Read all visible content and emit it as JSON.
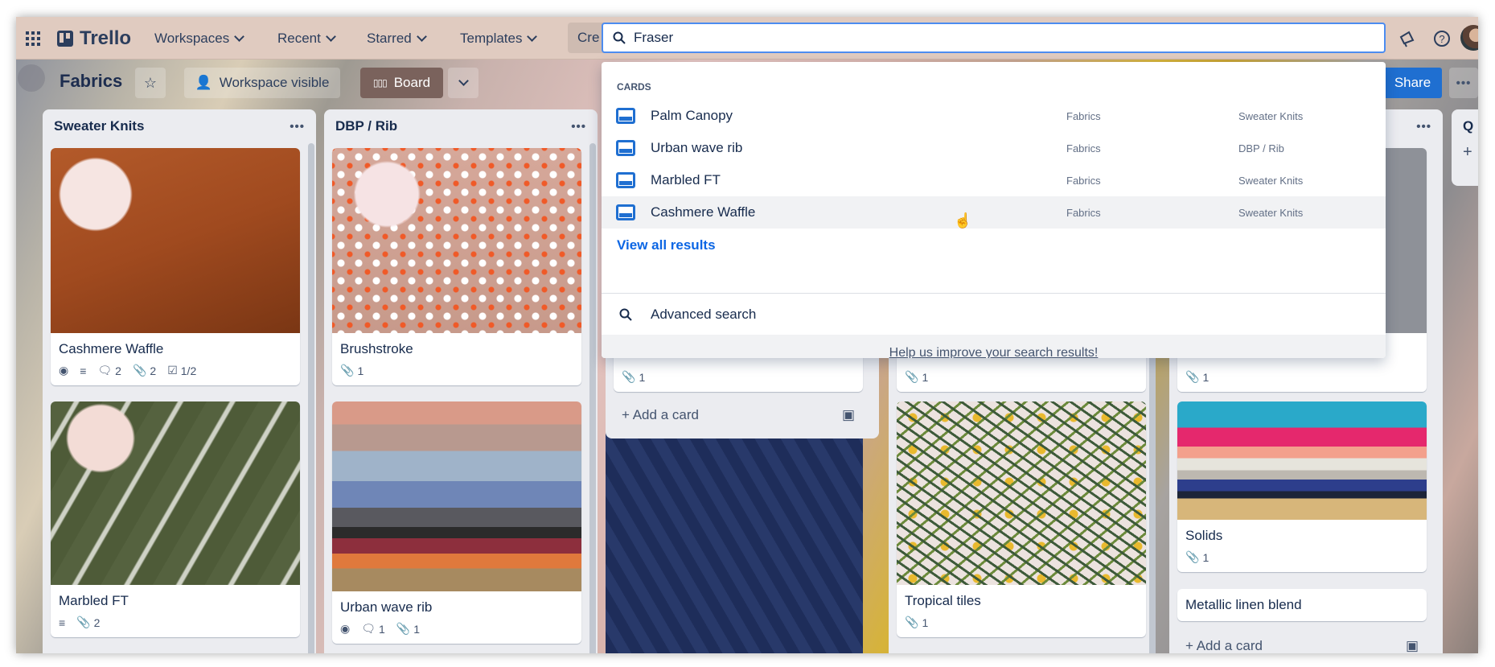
{
  "topbar": {
    "logo": "Trello",
    "nav": [
      "Workspaces",
      "Recent",
      "Starred",
      "Templates"
    ],
    "create_label": "Cre",
    "search_value": "Fraser"
  },
  "board": {
    "title": "Fabrics",
    "visibility": "Workspace visible",
    "view": "Board",
    "share": "Share"
  },
  "lists": [
    {
      "title": "Sweater Knits",
      "cards": [
        {
          "title": "Cashmere Waffle",
          "badges": {
            "comments": "2",
            "attachments": "2",
            "checklist": "1/2"
          }
        },
        {
          "title": "Marbled FT",
          "badges": {
            "attachments": "2"
          }
        }
      ]
    },
    {
      "title": "DBP / Rib",
      "cards": [
        {
          "title": "Brushstroke",
          "badges": {
            "attachments": "1"
          }
        },
        {
          "title": "Urban wave rib",
          "badges": {
            "comments": "1",
            "attachments": "1"
          }
        }
      ]
    },
    {
      "cards": [
        {
          "badges": {
            "attachments": "1"
          }
        }
      ],
      "add_card": "Add a card"
    },
    {
      "cards": [
        {
          "badges": {
            "attachments": "1"
          }
        },
        {
          "title": "Tropical tiles",
          "badges": {
            "attachments": "1"
          }
        }
      ]
    },
    {
      "cards": [
        {
          "badges": {
            "attachments": "1"
          }
        },
        {
          "title": "Solids",
          "badges": {
            "attachments": "1"
          }
        },
        {
          "title": "Metallic linen blend"
        }
      ],
      "add_card": "Add a card"
    },
    {
      "title": "Q"
    }
  ],
  "search_dropdown": {
    "section": "CARDS",
    "results": [
      {
        "title": "Palm Canopy",
        "board": "Fabrics",
        "list": "Sweater Knits"
      },
      {
        "title": "Urban wave rib",
        "board": "Fabrics",
        "list": "DBP / Rib"
      },
      {
        "title": "Marbled FT",
        "board": "Fabrics",
        "list": "Sweater Knits"
      },
      {
        "title": "Cashmere Waffle",
        "board": "Fabrics",
        "list": "Sweater Knits"
      }
    ],
    "view_all": "View all results",
    "advanced": "Advanced search",
    "feedback": "Help us improve your search results!"
  },
  "colors": {
    "topbar": "#e0cbc0",
    "accent": "#0c66e4",
    "share": "#1f6fd1",
    "board_button": "#7a625c"
  }
}
